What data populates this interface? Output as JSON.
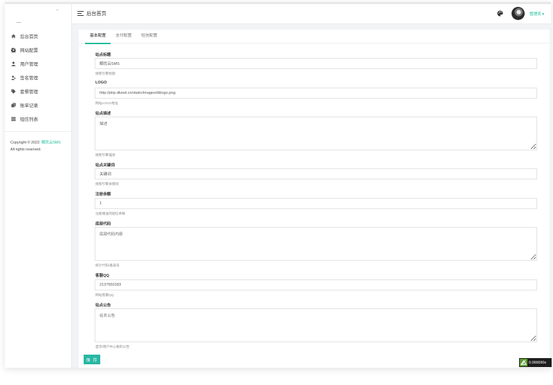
{
  "header": {
    "page_title": "后台首页",
    "username": "管理员 ▾"
  },
  "sidebar": {
    "items": [
      {
        "label": "后台首页",
        "icon": "home-icon"
      },
      {
        "label": "网站配置",
        "icon": "gear-icon"
      },
      {
        "label": "用户管理",
        "icon": "user-icon"
      },
      {
        "label": "签名管理",
        "icon": "user-edit-icon"
      },
      {
        "label": "套餐管理",
        "icon": "tag-icon"
      },
      {
        "label": "账单记录",
        "icon": "copy-icon"
      },
      {
        "label": "短信列表",
        "icon": "list-icon"
      }
    ],
    "copyright_prefix": "Copyright © 2022.",
    "copyright_brand": "解忧云SMS",
    "copyright_suffix": "All rights reserved."
  },
  "tabs": [
    "基本配置",
    "支付配置",
    "短信配置"
  ],
  "form": {
    "site_title": {
      "label": "站点标题",
      "value": "解忧云SMS",
      "help": "搜索引擎标题"
    },
    "logo": {
      "label": "LOGO",
      "value": "http://php.dkewl.cn/static/images/dklogo.png",
      "help": "网站LOGO地址"
    },
    "description": {
      "label": "站点描述",
      "value": "描述",
      "help": "搜索引擎描述"
    },
    "keywords": {
      "label": "站点关键词",
      "value": "关键词",
      "help": "搜索引擎关键词"
    },
    "register_balance": {
      "label": "注册余额",
      "value": "1",
      "help": "注册赠送的短信条数"
    },
    "footer_code": {
      "label": "底部代码",
      "value": "底部代码内容",
      "help": "统计代码/备案号"
    },
    "service_qq": {
      "label": "客服QQ",
      "value": "2137650183",
      "help": "网站客服QQ"
    },
    "announcement": {
      "label": "站点公告",
      "value": "站长公告",
      "help": "首页/用户中心看的公告"
    }
  },
  "save_label": "保 存",
  "debug_time": "0.066690s",
  "colors": {
    "accent": "#1bbc9b",
    "button": "#27b7a3"
  }
}
